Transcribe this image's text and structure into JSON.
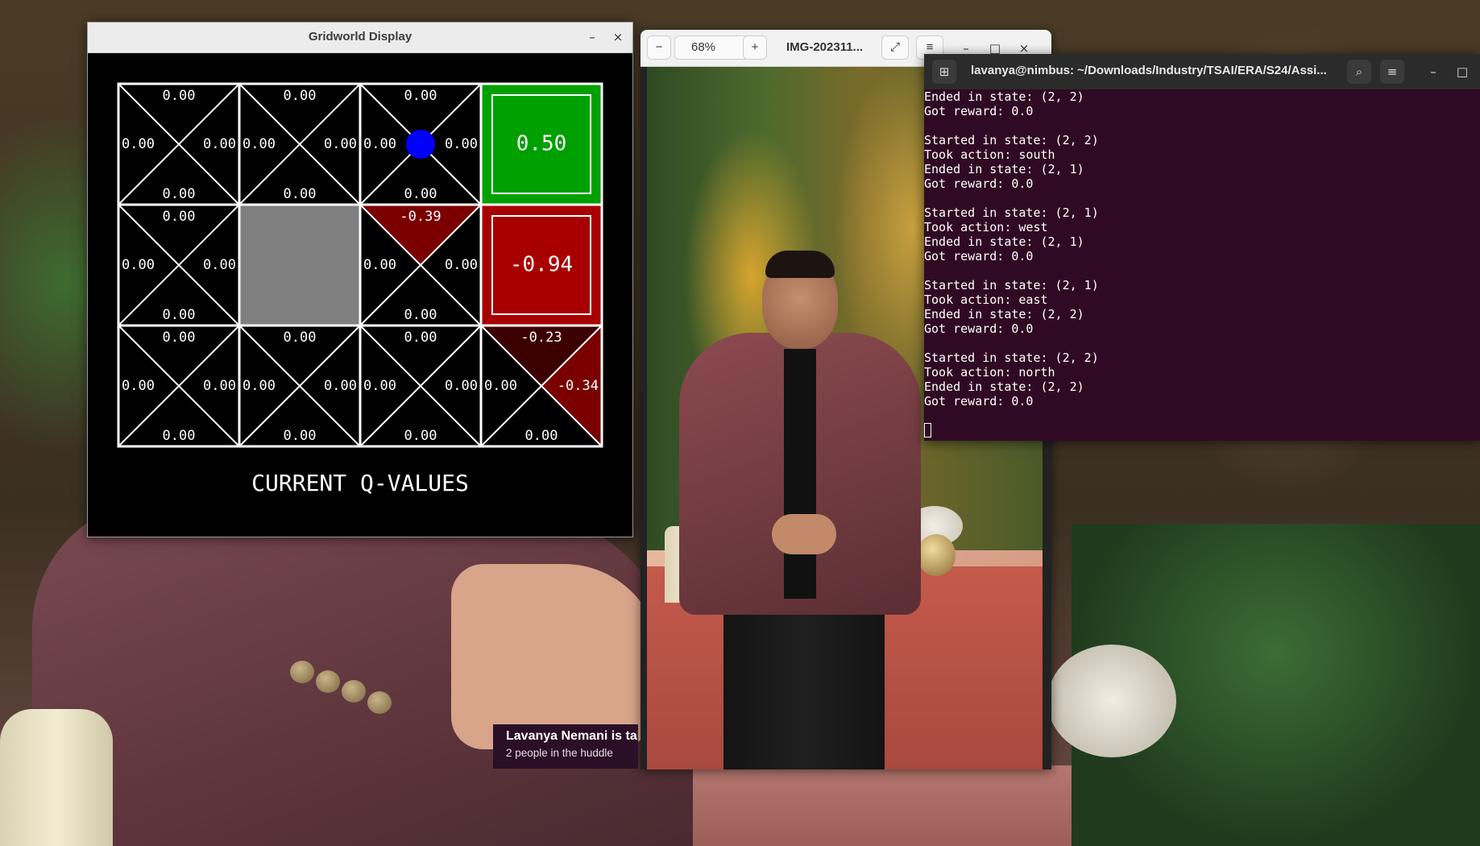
{
  "gridworld": {
    "window_title": "Gridworld Display",
    "minimize_glyph": "–",
    "close_glyph": "×",
    "caption": "CURRENT Q-VALUES",
    "agent_position": {
      "row": 0,
      "col": 2
    },
    "colors": {
      "background": "#000000",
      "grid_line": "#ffffff",
      "wall": "#808080",
      "positive_exit": "#00a000",
      "negative_exit": "#a80000",
      "negative_wedge_strong": "#7a0000",
      "negative_wedge_weak": "#3c0000",
      "agent": "#0000ff"
    },
    "rows": [
      [
        {
          "type": "q",
          "north": "0.00",
          "east": "0.00",
          "south": "0.00",
          "west": "0.00"
        },
        {
          "type": "q",
          "north": "0.00",
          "east": "0.00",
          "south": "0.00",
          "west": "0.00"
        },
        {
          "type": "q",
          "north": "0.00",
          "east": "0.00",
          "south": "0.00",
          "west": "0.00"
        },
        {
          "type": "exit",
          "value": "0.50",
          "color": "#00a000"
        }
      ],
      [
        {
          "type": "q",
          "north": "0.00",
          "east": "0.00",
          "south": "0.00",
          "west": "0.00"
        },
        {
          "type": "wall"
        },
        {
          "type": "q",
          "north": "-0.39",
          "east": "0.00",
          "south": "0.00",
          "west": "0.00"
        },
        {
          "type": "exit",
          "value": "-0.94",
          "color": "#a80000"
        }
      ],
      [
        {
          "type": "q",
          "north": "0.00",
          "east": "0.00",
          "south": "0.00",
          "west": "0.00"
        },
        {
          "type": "q",
          "north": "0.00",
          "east": "0.00",
          "south": "0.00",
          "west": "0.00"
        },
        {
          "type": "q",
          "north": "0.00",
          "east": "0.00",
          "south": "0.00",
          "west": "0.00"
        },
        {
          "type": "q",
          "north": "-0.23",
          "east": "-0.34",
          "south": "0.00",
          "west": "0.00"
        }
      ]
    ]
  },
  "image_viewer": {
    "zoom_out_icon": "−",
    "zoom_level": "68%",
    "zoom_dropdown_icon": "⌄",
    "zoom_in_icon": "+",
    "file_title": "IMG-202311...",
    "fullscreen_icon": "⤢",
    "menu_icon": "≡",
    "minimize_glyph": "–",
    "maximize_glyph": "□",
    "close_glyph": "×"
  },
  "terminal": {
    "title": "lavanya@nimbus: ~/Downloads/Industry/TSAI/ERA/S24/Assi...",
    "new_tab_icon": "⊞",
    "search_icon": "⌕",
    "menu_icon": "≡",
    "minimize_glyph": "–",
    "maximize_glyph": "□",
    "lines": [
      "Ended in state: (2, 2)",
      "Got reward: 0.0",
      "",
      "Started in state: (2, 2)",
      "Took action: south",
      "Ended in state: (2, 1)",
      "Got reward: 0.0",
      "",
      "Started in state: (2, 1)",
      "Took action: west",
      "Ended in state: (2, 1)",
      "Got reward: 0.0",
      "",
      "Started in state: (2, 1)",
      "Took action: east",
      "Ended in state: (2, 2)",
      "Got reward: 0.0",
      "",
      "Started in state: (2, 2)",
      "Took action: north",
      "Ended in state: (2, 2)",
      "Got reward: 0.0",
      ""
    ]
  },
  "huddle": {
    "title": "Lavanya Nemani is talk",
    "subtitle": "2 people in the huddle"
  }
}
